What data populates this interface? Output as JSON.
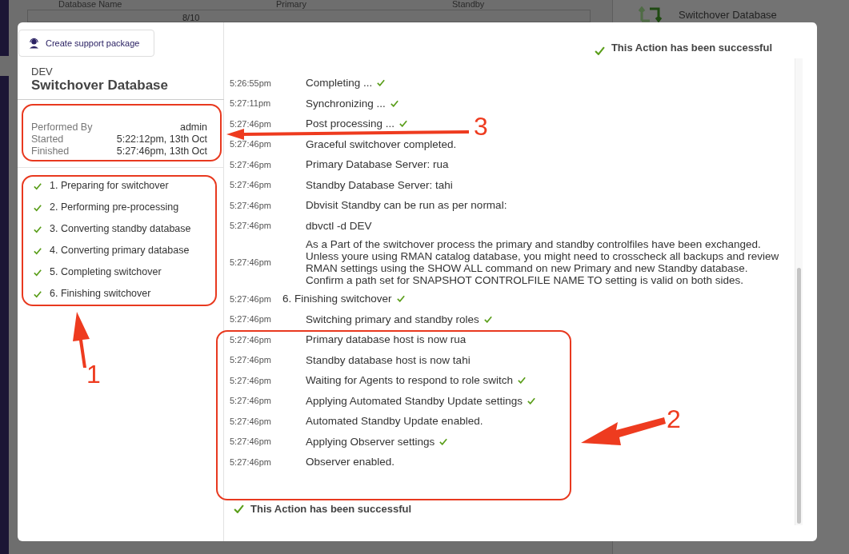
{
  "background": {
    "columns": [
      "Database Name",
      "Primary",
      "Standby"
    ],
    "counter": "8/10",
    "side_action": "Switchover Database"
  },
  "modal": {
    "support_button": "Create support package",
    "database": "DEV",
    "title": "Switchover Database",
    "details": [
      {
        "label": "Performed By",
        "value": "admin"
      },
      {
        "label": "Started",
        "value": "5:22:12pm, 13th Oct"
      },
      {
        "label": "Finished",
        "value": "5:27:46pm, 13th Oct"
      }
    ],
    "steps": [
      {
        "label": "1. Preparing for switchover",
        "done": true
      },
      {
        "label": "2. Performing pre-processing",
        "done": true
      },
      {
        "label": "3. Converting standby database",
        "done": true
      },
      {
        "label": "4. Converting primary database",
        "done": true
      },
      {
        "label": "5. Completing switchover",
        "done": true
      },
      {
        "label": "6. Finishing switchover",
        "done": true
      }
    ],
    "status_top": {
      "text": "This Action has been successful",
      "success": true
    },
    "log": [
      {
        "kind": "entry",
        "time": "5:26:55pm",
        "text": "Completing ...",
        "done": true
      },
      {
        "kind": "entry",
        "time": "5:27:11pm",
        "text": "Synchronizing ...",
        "done": true
      },
      {
        "kind": "entry",
        "time": "5:27:46pm",
        "text": "Post processing ...",
        "done": true
      },
      {
        "kind": "entry",
        "time": "5:27:46pm",
        "text": "Graceful switchover completed.",
        "done": false
      },
      {
        "kind": "entry",
        "time": "5:27:46pm",
        "text": "Primary Database Server: rua",
        "done": false
      },
      {
        "kind": "entry",
        "time": "5:27:46pm",
        "text": "Standby Database Server: tahi",
        "done": false
      },
      {
        "kind": "entry",
        "time": "5:27:46pm",
        "text": "Dbvisit Standby can be run as per normal:",
        "done": false
      },
      {
        "kind": "entry",
        "time": "5:27:46pm",
        "text": "dbvctl -d DEV",
        "done": false
      },
      {
        "kind": "entry",
        "time": "5:27:46pm",
        "text": "As a Part of the switchover process the primary and standby controlfiles have been exchanged. Unless youre using RMAN catalog database, you might need to crosscheck all backups and review RMAN settings using the SHOW ALL command on new Primary and new Standby database. Confirm a path set for SNAPSHOT CONTROLFILE NAME TO setting is valid on both sides.",
        "done": false
      },
      {
        "kind": "heading",
        "time": "5:27:46pm",
        "text": "6. Finishing switchover",
        "done": true
      },
      {
        "kind": "entry",
        "time": "5:27:46pm",
        "text": "Switching primary and standby roles",
        "done": true
      },
      {
        "kind": "entry",
        "time": "5:27:46pm",
        "text": "Primary database host is now rua",
        "done": false
      },
      {
        "kind": "entry",
        "time": "5:27:46pm",
        "text": "Standby database host is now tahi",
        "done": false
      },
      {
        "kind": "entry",
        "time": "5:27:46pm",
        "text": "Waiting for Agents to respond to role switch",
        "done": true
      },
      {
        "kind": "entry",
        "time": "5:27:46pm",
        "text": "Applying Automated Standby Update settings",
        "done": true
      },
      {
        "kind": "entry",
        "time": "5:27:46pm",
        "text": "Automated Standby Update enabled.",
        "done": false
      },
      {
        "kind": "entry",
        "time": "5:27:46pm",
        "text": "Applying Observer settings",
        "done": true
      },
      {
        "kind": "entry",
        "time": "5:27:46pm",
        "text": "Observer enabled.",
        "done": false
      }
    ],
    "status_bottom": {
      "text": "This Action has been successful",
      "success": true
    }
  },
  "annotations": [
    {
      "number": "1"
    },
    {
      "number": "2"
    },
    {
      "number": "3"
    }
  ]
}
